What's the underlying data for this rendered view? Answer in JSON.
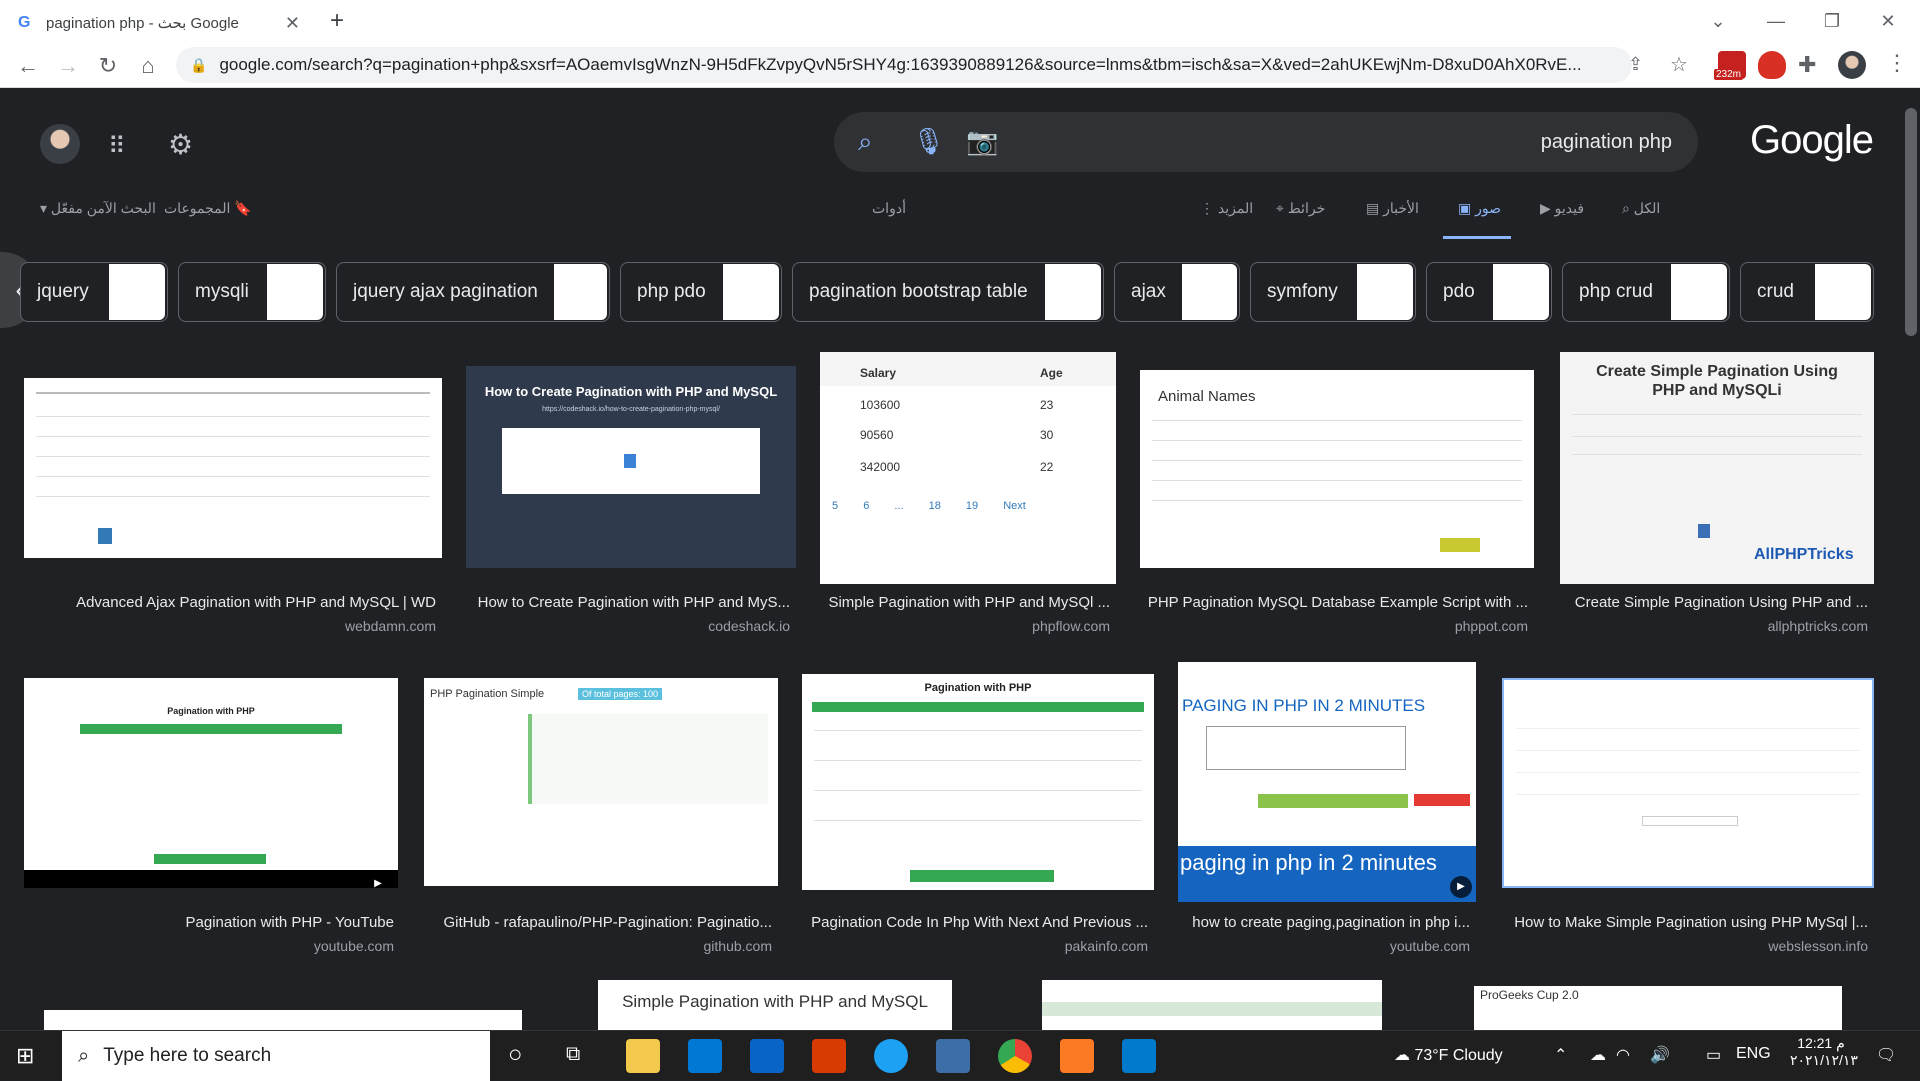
{
  "browser": {
    "tab_title": "pagination php - بحث Google",
    "url": "google.com/search?q=pagination+php&sxsrf=AOaemvIsgWnzN-9H5dFkZvpyQvN5rSHY4g:1639390889126&source=lnms&tbm=isch&sa=X&ved=2ahUKEwjNm-D8xuD0AhX0RvE...",
    "ext_badge": "232m"
  },
  "google": {
    "query": "pagination php",
    "logo": "Google",
    "tabs": [
      "الكل",
      "فيديو",
      "صور",
      "الأخبار",
      "خرائط",
      "المزيد"
    ],
    "tools": "أدوات",
    "collections": "المجموعات",
    "safesearch": "البحث الآمن مفعّل"
  },
  "chips": [
    "jquery",
    "mysqli",
    "jquery ajax pagination",
    "php pdo",
    "pagination bootstrap table",
    "ajax",
    "symfony",
    "pdo",
    "php crud",
    "crud"
  ],
  "results": [
    {
      "caption": "Advanced Ajax Pagination with PHP and MySQL | WD",
      "source": "webdamn.com"
    },
    {
      "caption": "How to Create Pagination with PHP and MyS...",
      "source": "codeshack.io"
    },
    {
      "caption": "Simple Pagination with PHP and MySQl ...",
      "source": "phpflow.com"
    },
    {
      "caption": "PHP Pagination MySQL Database Example Script with ...",
      "source": "phppot.com"
    },
    {
      "caption": "Create Simple Pagination Using PHP and ...",
      "source": "allphptricks.com"
    },
    {
      "caption": "Pagination with PHP - YouTube",
      "source": "youtube.com"
    },
    {
      "caption": "GitHub - rafapaulino/PHP-Pagination: Paginatio...",
      "source": "github.com"
    },
    {
      "caption": "Pagination Code In Php With Next And Previous ...",
      "source": "pakainfo.com"
    },
    {
      "caption": "how to create paging,pagination in php i...",
      "source": "youtube.com"
    },
    {
      "caption": "How to Make Simple Pagination using PHP MySql |...",
      "source": "webslesson.info"
    }
  ],
  "thumb_text": {
    "codeshack_title": "How to Create Pagination with PHP and MySQL",
    "codeshack_url": "https://codeshack.io/how-to-create-pagination-php-mysql/",
    "phpflow_salary": "Salary",
    "phpflow_age": "Age",
    "phpflow_rows": [
      [
        "103600",
        "23"
      ],
      [
        "90560",
        "30"
      ],
      [
        "342000",
        "22"
      ]
    ],
    "phpflow_pages": [
      "5",
      "6",
      "...",
      "18",
      "19",
      "Next"
    ],
    "phppot_title": "Animal Names",
    "allphp_title": "Create Simple Pagination Using PHP and MySQLi",
    "allphp_brand": "AllPHPTricks",
    "yt_title": "Pagination with PHP",
    "gh_title": "PHP Pagination Simple",
    "gh_badge": "Of total pages: 100",
    "pakainfo_title": "Pagination with PHP",
    "paging_title": "PAGING IN PHP IN 2 MINUTES",
    "paging_sub": "paging in php in 2 minutes",
    "row3_a": "Simple Pagination with PHP and MySQL",
    "row3_b": "ProGeeks Cup 2.0"
  },
  "taskbar": {
    "search_placeholder": "Type here to search",
    "weather": "73°F  Cloudy",
    "lang": "ENG",
    "time": "12:21 م",
    "date": "٢٠٢١/١٢/١٣"
  },
  "colors": {
    "bg": "#202124",
    "accent": "#8ab4f8",
    "green": "#34a853"
  }
}
